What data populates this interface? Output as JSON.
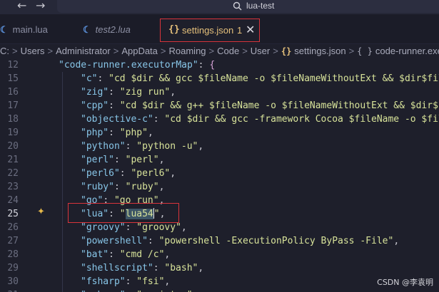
{
  "titlebar": {
    "back_icon": "arrow-left-icon",
    "forward_icon": "arrow-right-icon",
    "search_label": "lua-test"
  },
  "tabs": [
    {
      "label": "main.lua",
      "icon": "lua-icon"
    },
    {
      "label": "test2.lua",
      "icon": "lua-icon"
    },
    {
      "label": "settings.json",
      "icon": "braces-icon",
      "problems": "1",
      "active": true
    }
  ],
  "breadcrumb": {
    "parts": [
      "C:",
      "Users",
      "Administrator",
      "AppData",
      "Roaming",
      "Code",
      "User"
    ],
    "file": "settings.json",
    "symbol_icon": "{ }",
    "symbol": "code-runner.execu"
  },
  "editor": {
    "lines": [
      {
        "n": "12",
        "k": "\"code-runner.executorMap\"",
        "v": "{",
        "indent": 1
      },
      {
        "n": "15",
        "k": "\"c\"",
        "v": "\"cd $dir && gcc $fileName -o $fileNameWithoutExt && $dir$fil",
        "indent": 2
      },
      {
        "n": "16",
        "k": "\"zig\"",
        "v": "\"zig run\"",
        "indent": 2
      },
      {
        "n": "17",
        "k": "\"cpp\"",
        "v": "\"cd $dir && g++ $fileName -o $fileNameWithoutExt && $dir$fil",
        "indent": 2
      },
      {
        "n": "18",
        "k": "\"objective-c\"",
        "v": "\"cd $dir && gcc -framework Cocoa $fileName -o $fileN",
        "indent": 2
      },
      {
        "n": "19",
        "k": "\"php\"",
        "v": "\"php\"",
        "indent": 2
      },
      {
        "n": "20",
        "k": "\"python\"",
        "v": "\"python -u\"",
        "indent": 2
      },
      {
        "n": "21",
        "k": "\"perl\"",
        "v": "\"perl\"",
        "indent": 2
      },
      {
        "n": "22",
        "k": "\"perl6\"",
        "v": "\"perl6\"",
        "indent": 2
      },
      {
        "n": "23",
        "k": "\"ruby\"",
        "v": "\"ruby\"",
        "indent": 2
      },
      {
        "n": "24",
        "k": "\"go\"",
        "v": "\"go run\"",
        "indent": 2
      },
      {
        "n": "25",
        "k": "\"lua\"",
        "v": "\"lua54\"",
        "indent": 2,
        "current": true
      },
      {
        "n": "26",
        "k": "\"groovy\"",
        "v": "\"groovy\"",
        "indent": 2
      },
      {
        "n": "27",
        "k": "\"powershell\"",
        "v": "\"powershell -ExecutionPolicy ByPass -File\"",
        "indent": 2
      },
      {
        "n": "28",
        "k": "\"bat\"",
        "v": "\"cmd /c\"",
        "indent": 2
      },
      {
        "n": "29",
        "k": "\"shellscript\"",
        "v": "\"bash\"",
        "indent": 2
      },
      {
        "n": "30",
        "k": "\"fsharp\"",
        "v": "\"fsi\"",
        "indent": 2
      },
      {
        "n": "31",
        "k": "\"csharp\"",
        "v": "\"scriptcs\"",
        "indent": 2
      }
    ],
    "current_line_prefix": "\"lua\": \"",
    "current_line_selected": "lua54",
    "current_line_suffix": "\","
  },
  "watermark": "CSDN @李袁明",
  "colors": {
    "accent_red": "#d9343b",
    "json_yellow": "#e5c07b",
    "key_blue": "#88c6e8",
    "string_yellow": "#d8e39a"
  }
}
